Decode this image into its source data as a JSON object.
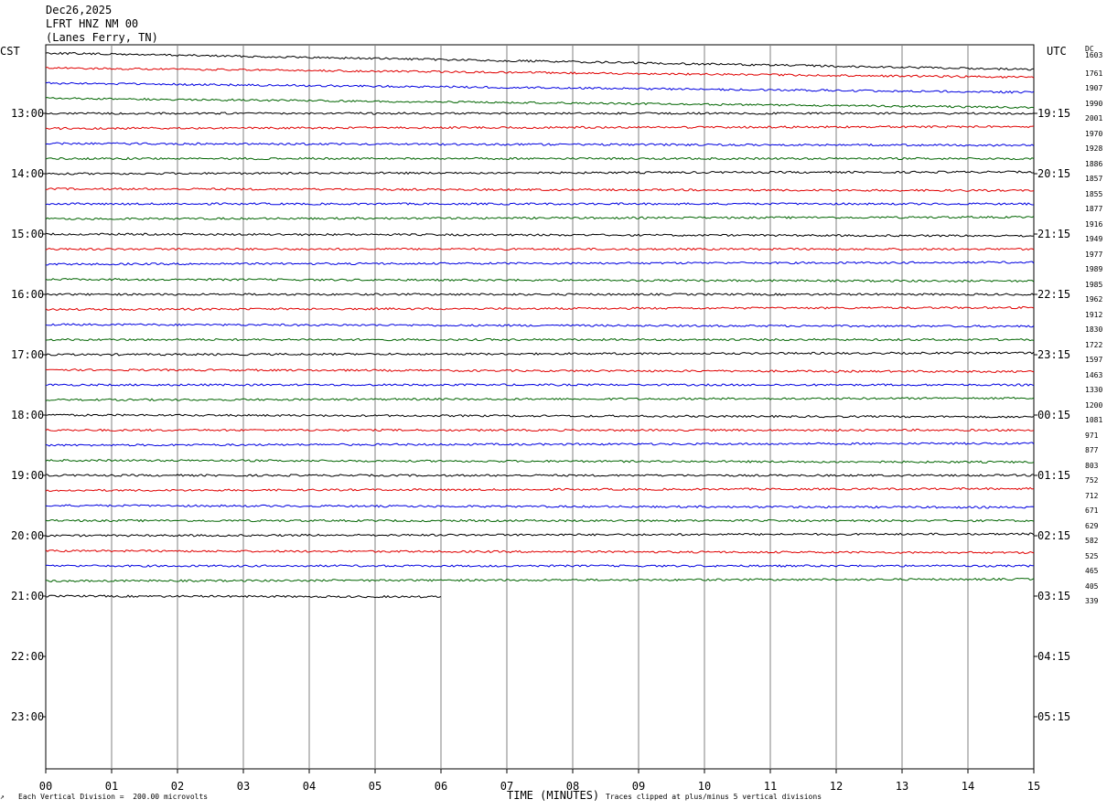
{
  "header": {
    "date": "Dec26,2025",
    "station": "LFRT HNZ NM 00",
    "location": "(Lanes Ferry, TN)"
  },
  "left_axis_title": "CST",
  "right_axis_title": "UTC",
  "dc_header": "DC",
  "footer": {
    "scale": "Each Vertical Division =  200.00 microvolts",
    "xlabel": "TIME (MINUTES)",
    "clip": "Traces clipped at plus/minus 5 vertical divisions",
    "corner_mark": "↗"
  },
  "colors": {
    "trace_cycle": [
      "#000000",
      "#e00000",
      "#0000e0",
      "#006400"
    ],
    "grid": "#808080"
  },
  "chart_data": {
    "type": "line",
    "title": "",
    "xlabel": "TIME (MINUTES)",
    "x_ticks": [
      "00",
      "01",
      "02",
      "03",
      "04",
      "05",
      "06",
      "07",
      "08",
      "09",
      "10",
      "11",
      "12",
      "13",
      "14",
      "15"
    ],
    "xlim": [
      0,
      15
    ],
    "minutes_per_line": 15,
    "traces_per_hour": 4,
    "hour_labels_cst": [
      "13:00",
      "14:00",
      "15:00",
      "16:00",
      "17:00",
      "18:00",
      "19:00",
      "20:00",
      "21:00",
      "22:00",
      "23:00"
    ],
    "hour_labels_utc": [
      "19:15",
      "20:15",
      "21:15",
      "22:15",
      "23:15",
      "00:15",
      "01:15",
      "02:15",
      "03:15",
      "04:15",
      "05:15"
    ],
    "dc_offsets": [
      "1603",
      "1761",
      "1907",
      "1990",
      "2001",
      "1970",
      "1928",
      "1886",
      "1857",
      "1855",
      "1877",
      "1916",
      "1949",
      "1977",
      "1989",
      "1985",
      "1962",
      "1912",
      "1830",
      "1722",
      "1597",
      "1463",
      "1330",
      "1200",
      "1081",
      "971",
      "877",
      "803",
      "752",
      "712",
      "671",
      "629",
      "582",
      "525",
      "465",
      "405",
      "339"
    ],
    "last_trace_end_minute": 6.0,
    "grid": true
  }
}
